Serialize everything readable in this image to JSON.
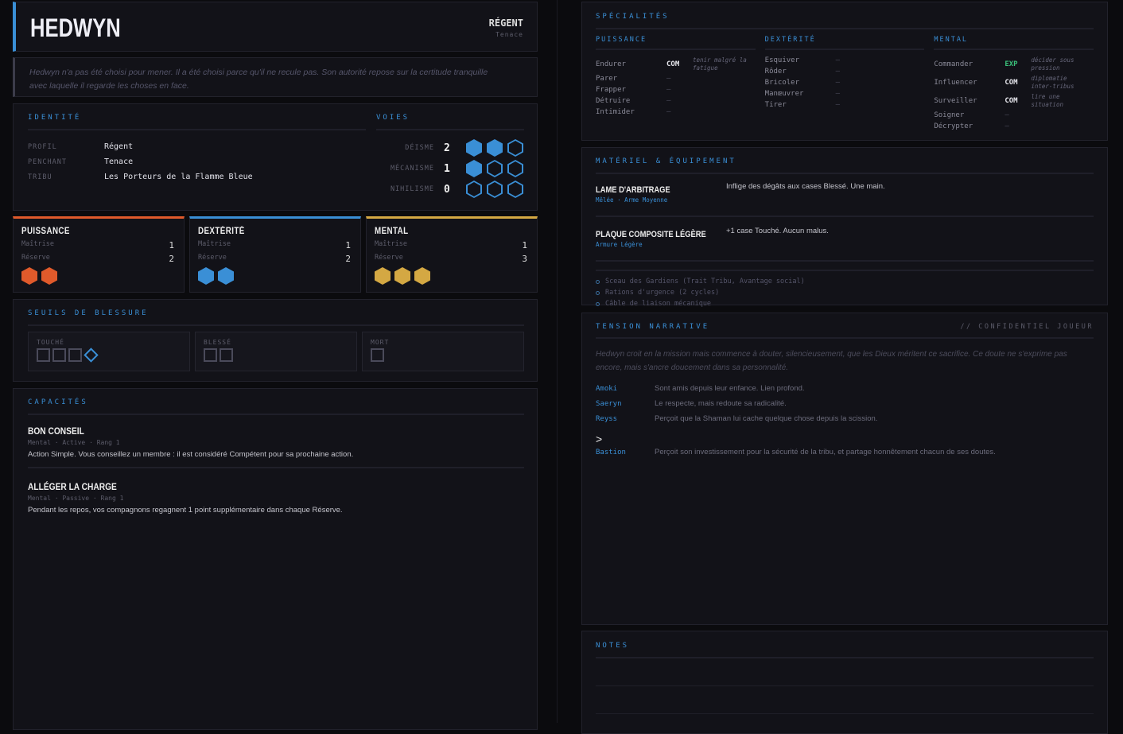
{
  "header": {
    "name": "HEDWYN",
    "role": "RÉGENT",
    "trait": "Tenace"
  },
  "quote": "Hedwyn n'a pas été choisi pour mener. Il a été choisi parce qu'il ne recule pas. Son autorité repose sur la certitude tranquille avec laquelle il regarde les choses en face.",
  "identity": {
    "title": "IDENTITÉ",
    "rows": [
      {
        "label": "PROFIL",
        "value": "Régent"
      },
      {
        "label": "PENCHANT",
        "value": "Tenace"
      },
      {
        "label": "TRIBU",
        "value": "Les Porteurs de la Flamme Bleue"
      }
    ]
  },
  "voies": {
    "title": "VOIES",
    "max": 3,
    "items": [
      {
        "label": "DÉISME",
        "value": 2
      },
      {
        "label": "MÉCANISME",
        "value": 1
      },
      {
        "label": "NIHILISME",
        "value": 0
      }
    ]
  },
  "stats": [
    {
      "name": "PUISSANCE",
      "color": "#e05a2b",
      "mastery_label": "Maîtrise",
      "mastery": 1,
      "reserve_label": "Réserve",
      "reserve": 2
    },
    {
      "name": "DEXTÉRITÉ",
      "color": "#3a8fd6",
      "mastery_label": "Maîtrise",
      "mastery": 1,
      "reserve_label": "Réserve",
      "reserve": 2
    },
    {
      "name": "MENTAL",
      "color": "#d4a843",
      "mastery_label": "Maîtrise",
      "mastery": 1,
      "reserve_label": "Réserve",
      "reserve": 3
    }
  ],
  "wounds": {
    "title": "SEUILS DE BLESSURE",
    "groups": [
      {
        "label": "TOUCHÉ",
        "boxes": 3,
        "armor": 1
      },
      {
        "label": "BLESSÉ",
        "boxes": 2
      },
      {
        "label": "MORT",
        "boxes": 1
      }
    ]
  },
  "capacities": {
    "title": "CAPACITÉS",
    "items": [
      {
        "name": "BON CONSEIL",
        "meta": "Mental · Active · Rang 1",
        "desc": "Action Simple. Vous conseillez un membre : il est considéré Compétent pour sa prochaine action."
      },
      {
        "name": "ALLÉGER LA CHARGE",
        "meta": "Mental · Passive · Rang 1",
        "desc": "Pendant les repos, vos compagnons regagnent 1 point supplémentaire dans chaque Réserve."
      }
    ]
  },
  "specialties": {
    "title": "SPÉCIALITÉS",
    "columns": [
      {
        "title": "PUISSANCE",
        "items": [
          {
            "name": "Endurer",
            "level": "COM",
            "note": "tenir malgré la fatigue"
          },
          {
            "name": "Parer",
            "level": "–"
          },
          {
            "name": "Frapper",
            "level": "–"
          },
          {
            "name": "Détruire",
            "level": "–"
          },
          {
            "name": "Intimider",
            "level": "–"
          }
        ]
      },
      {
        "title": "DEXTÉRITÉ",
        "items": [
          {
            "name": "Esquiver",
            "level": "–"
          },
          {
            "name": "Rôder",
            "level": "–"
          },
          {
            "name": "Bricoler",
            "level": "–"
          },
          {
            "name": "Manœuvrer",
            "level": "–"
          },
          {
            "name": "Tirer",
            "level": "–"
          }
        ]
      },
      {
        "title": "MENTAL",
        "items": [
          {
            "name": "Commander",
            "level": "EXP",
            "note": "décider sous pression"
          },
          {
            "name": "Influencer",
            "level": "COM",
            "note": "diplomatie inter-tribus"
          },
          {
            "name": "Surveiller",
            "level": "COM",
            "note": "lire une situation"
          },
          {
            "name": "Soigner",
            "level": "–"
          },
          {
            "name": "Décrypter",
            "level": "–"
          }
        ]
      }
    ]
  },
  "equipment": {
    "title": "MATÉRIEL & ÉQUIPEMENT",
    "items": [
      {
        "name": "LAME D'ARBITRAGE",
        "meta": "Mêlée · Arme Moyenne",
        "desc": "Inflige des dégâts aux cases Blessé. Une main."
      },
      {
        "name": "PLAQUE COMPOSITE LÉGÈRE",
        "meta": "Armure Légère",
        "desc": "+1 case Touché. Aucun malus."
      }
    ],
    "misc": [
      "Sceau des Gardiens (Trait Tribu, Avantage social)",
      "Rations d'urgence (2 cycles)",
      "Câble de liaison mécanique"
    ]
  },
  "tension": {
    "title": "TENSION NARRATIVE",
    "tag": "// CONFIDENTIEL JOUEUR",
    "text": "Hedwyn croit en la mission mais commence à douter, silencieusement, que les Dieux méritent ce sacrifice. Ce doute ne s'exprime pas encore, mais s'ancre doucement dans sa personnalité.",
    "relations": [
      {
        "name": "Amoki",
        "desc": "Sont amis depuis leur enfance. Lien profond."
      },
      {
        "name": "Saeryn",
        "desc": "Le respecte, mais redoute sa radicalité."
      },
      {
        "name": "Reyss",
        "desc": "Perçoit que la Shaman lui cache quelque chose depuis la scission."
      },
      {
        "name": "Bastion",
        "desc": "Perçoit son investissement pour la sécurité de la tribu, et partage honnêtement chacun de ses doutes.",
        "marker": ">"
      }
    ]
  },
  "notes": {
    "title": "NOTES"
  }
}
